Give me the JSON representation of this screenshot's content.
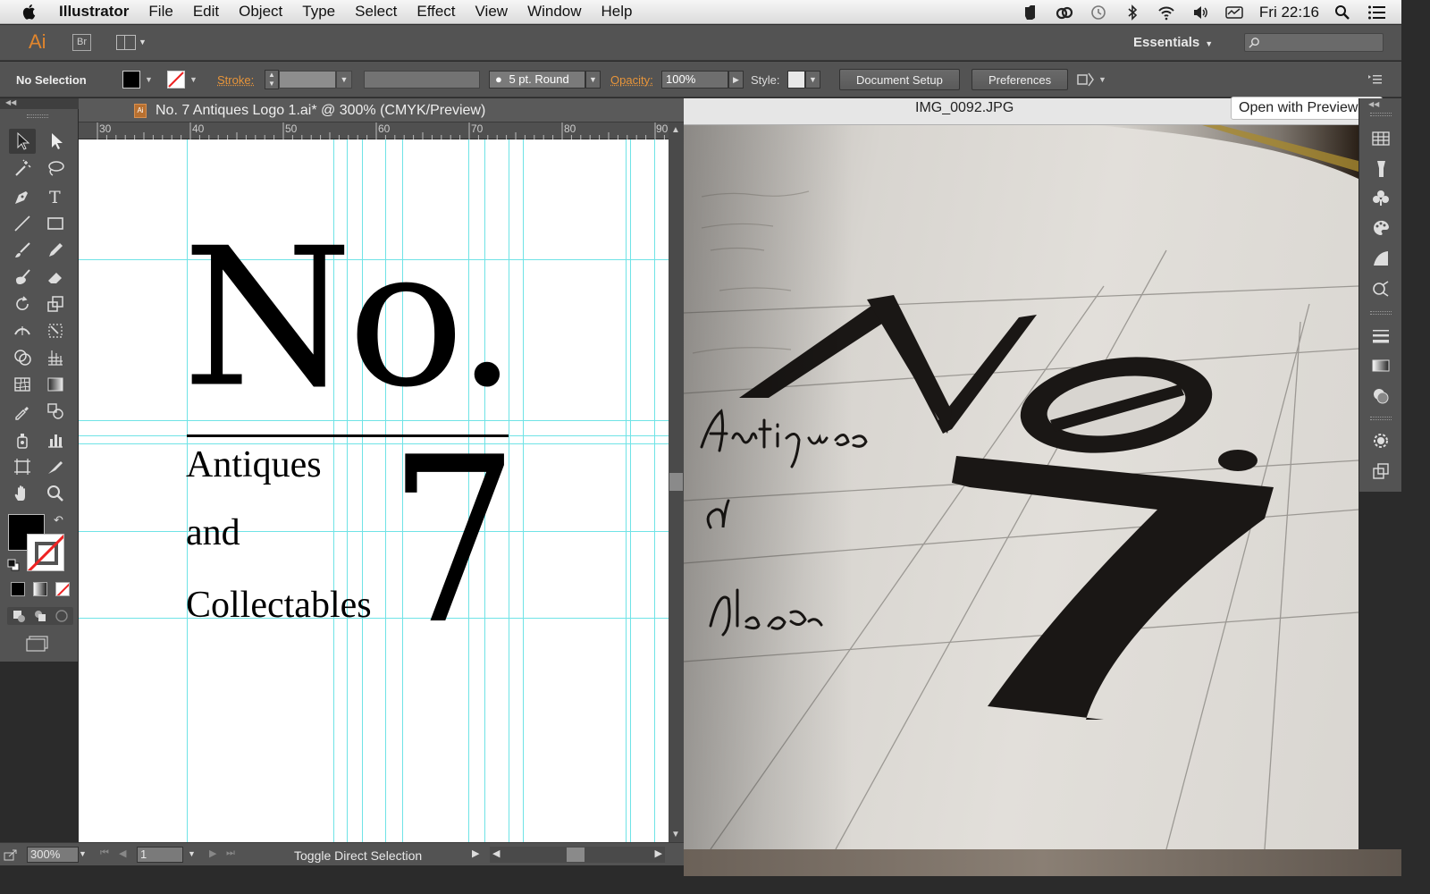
{
  "menubar": {
    "app_name": "Illustrator",
    "items": [
      "File",
      "Edit",
      "Object",
      "Type",
      "Select",
      "Effect",
      "View",
      "Window",
      "Help"
    ],
    "clock": "Fri 22:16"
  },
  "appbar": {
    "logo": "Ai",
    "bridge": "Br",
    "workspace": "Essentials"
  },
  "control": {
    "selection": "No Selection",
    "stroke_label": "Stroke:",
    "brush": "5 pt. Round",
    "opacity_label": "Opacity:",
    "opacity_value": "100%",
    "style_label": "Style:",
    "document_setup": "Document Setup",
    "preferences": "Preferences"
  },
  "document": {
    "tab_title": "No. 7 Antiques Logo 1.ai* @ 300% (CMYK/Preview)",
    "ruler_ticks": [
      "30",
      "40",
      "50",
      "60",
      "70",
      "80",
      "90"
    ],
    "logo": {
      "no": "No.",
      "seven": "7",
      "line1": "Antiques",
      "line2": "and",
      "line3": "Collectables"
    }
  },
  "status": {
    "zoom": "300%",
    "page": "1",
    "text": "Toggle Direct Selection"
  },
  "preview": {
    "title": "IMG_0092.JPG",
    "open_button": "Open with Preview",
    "sketch_text": {
      "no": "No",
      "seven": "7",
      "antiques": "Antiques",
      "and": "nd",
      "collectables": "lables"
    }
  },
  "colors": {
    "guide": "#6fe3e6",
    "ui_dark": "#535353",
    "ai_orange": "#e0852d"
  }
}
